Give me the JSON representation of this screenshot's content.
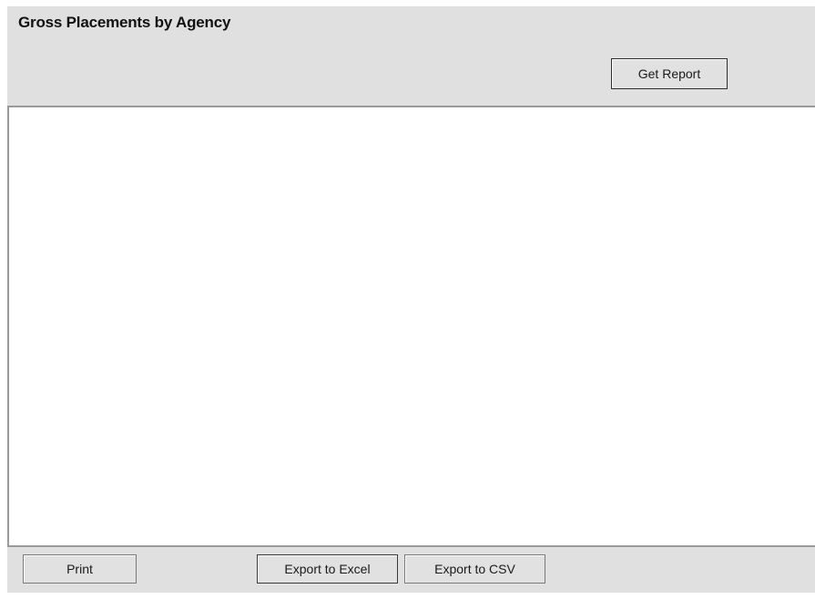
{
  "window": {
    "title": "Gross Placements by Agency"
  },
  "toolbar": {
    "get_report_label": "Get Report"
  },
  "footer": {
    "print_label": "Print",
    "export_excel_label": "Export to Excel",
    "export_csv_label": "Export to CSV"
  },
  "colors": {
    "panel_background": "#e0e0e0",
    "report_background": "#ffffff",
    "button_background": "#e1e1e1"
  }
}
